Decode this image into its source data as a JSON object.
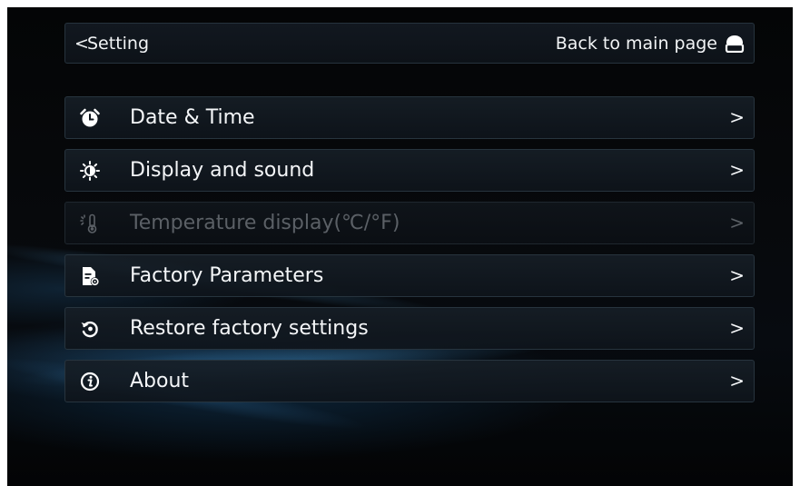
{
  "header": {
    "back_label": "Setting",
    "home_label": "Back to main page",
    "back_icon": "chevron-left-icon",
    "home_icon": "home-icon"
  },
  "menu": {
    "items": [
      {
        "label": "Date & Time",
        "icon": "alarm-clock-icon",
        "enabled": true
      },
      {
        "label": "Display and sound",
        "icon": "brightness-icon",
        "enabled": true
      },
      {
        "label": "Temperature display(℃/°F)",
        "icon": "thermometer-icon",
        "enabled": false
      },
      {
        "label": "Factory Parameters",
        "icon": "document-gear-icon",
        "enabled": true
      },
      {
        "label": "Restore factory settings",
        "icon": "restore-icon",
        "enabled": true
      },
      {
        "label": "About",
        "icon": "info-icon",
        "enabled": true
      }
    ],
    "chevron": ">"
  },
  "colors": {
    "text": "#f4f6f8",
    "disabled_text": "#5b6066",
    "row_border": "#27343e",
    "background": "#05070a"
  }
}
